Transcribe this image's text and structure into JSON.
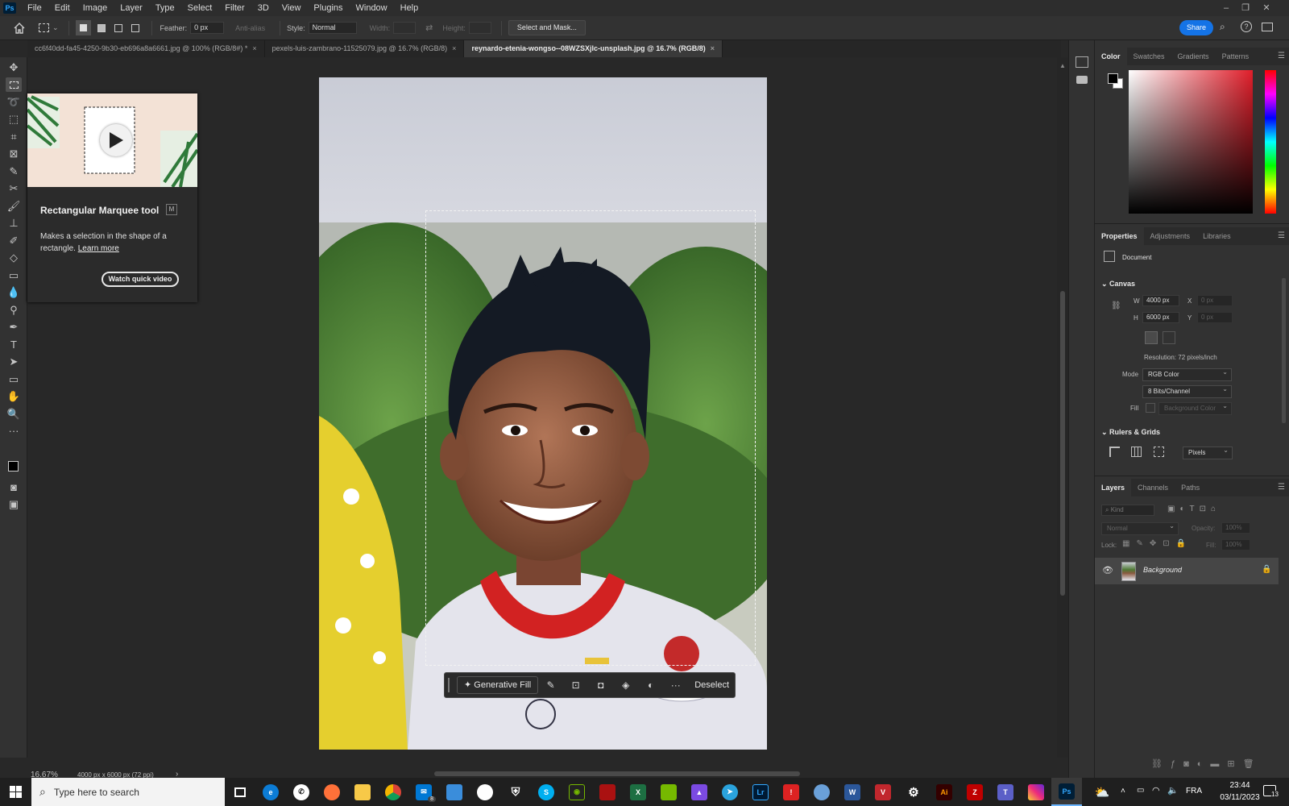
{
  "app": {
    "logo": "Ps"
  },
  "menu": [
    "File",
    "Edit",
    "Image",
    "Layer",
    "Type",
    "Select",
    "Filter",
    "3D",
    "View",
    "Plugins",
    "Window",
    "Help"
  ],
  "window_controls": {
    "minimize": "–",
    "restore": "❐",
    "close": "✕"
  },
  "options_bar": {
    "feather_label": "Feather:",
    "feather_value": "0 px",
    "anti_alias": "Anti-alias",
    "style_label": "Style:",
    "style_value": "Normal",
    "width_label": "Width:",
    "height_label": "Height:",
    "select_mask": "Select and Mask...",
    "share": "Share"
  },
  "tabs": [
    {
      "label": "cc6f40dd-fa45-4250-9b30-eb696a8a6661.jpg @ 100% (RGB/8#) *"
    },
    {
      "label": "pexels-luis-zambrano-11525079.jpg @ 16.7% (RGB/8)"
    },
    {
      "label": "reynardo-etenia-wongso--08WZSXjlc-unsplash.jpg @ 16.7% (RGB/8)"
    }
  ],
  "tab_close": "×",
  "tooltip": {
    "title": "Rectangular Marquee tool",
    "shortcut": "M",
    "desc": "Makes a selection in the shape of a rectangle.",
    "learn_more": "Learn more",
    "watch": "Watch quick video"
  },
  "context_bar": {
    "generative_fill": "Generative Fill",
    "more": "···",
    "deselect": "Deselect"
  },
  "status": {
    "zoom": "16.67%",
    "doc_size": "4000 px x 6000 px (72 ppi)",
    "arrow": "›"
  },
  "color_panel": {
    "tabs": [
      "Color",
      "Swatches",
      "Gradients",
      "Patterns"
    ]
  },
  "properties": {
    "tabs": [
      "Properties",
      "Adjustments",
      "Libraries"
    ],
    "document": "Document",
    "canvas": "Canvas",
    "w_label": "W",
    "w_value": "4000 px",
    "h_label": "H",
    "h_value": "6000 px",
    "x_label": "X",
    "x_value": "0 px",
    "y_label": "Y",
    "y_value": "0 px",
    "resolution": "Resolution: 72 pixels/inch",
    "mode_label": "Mode",
    "mode_value": "RGB Color",
    "bits_value": "8 Bits/Channel",
    "fill_label": "Fill",
    "fill_value": "Background Color",
    "rulers_grids": "Rulers & Grids",
    "units_value": "Pixels"
  },
  "layers": {
    "tabs": [
      "Layers",
      "Channels",
      "Paths"
    ],
    "kind": "Kind",
    "blend": "Normal",
    "opacity_label": "Opacity:",
    "opacity_value": "100%",
    "lock_label": "Lock:",
    "fill_label": "Fill:",
    "fill_value": "100%",
    "layer_name": "Background"
  },
  "taskbar": {
    "search_placeholder": "Type here to search",
    "lang": "FRA",
    "time": "23:44",
    "date": "03/11/2023",
    "notif_count": "13",
    "teams_badge": "8"
  },
  "colors": {
    "accent": "#1473e6",
    "bg": "#282828",
    "panel": "#323232"
  }
}
